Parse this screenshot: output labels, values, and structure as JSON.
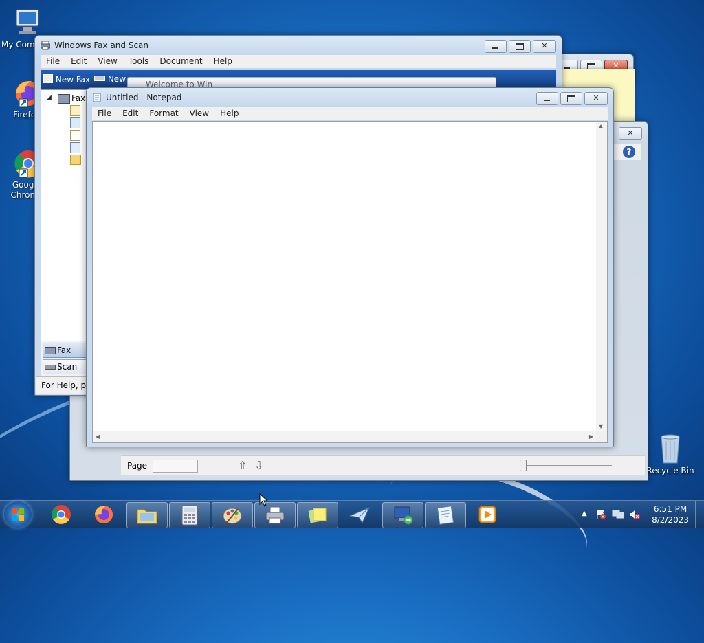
{
  "desktop": {
    "icons": [
      {
        "label": "My Computer"
      },
      {
        "label": "Firefox"
      },
      {
        "label": "Google Chrome"
      },
      {
        "label": "Recycle Bin"
      }
    ]
  },
  "fax_window": {
    "title": "Windows Fax and Scan",
    "menu": [
      "File",
      "Edit",
      "View",
      "Tools",
      "Document",
      "Help"
    ],
    "toolbar": {
      "new_fax": "New Fax",
      "new_scan": "New"
    },
    "welcome_tab": "Welcome to Win",
    "tree_root": "Fax",
    "nav": {
      "fax": "Fax",
      "scan": "Scan"
    },
    "status": "For Help, pre"
  },
  "viewer_window": {
    "page_label": "Page"
  },
  "notepad": {
    "title": "Untitled - Notepad",
    "menu": [
      "File",
      "Edit",
      "Format",
      "View",
      "Help"
    ],
    "content": ""
  },
  "taskbar": {
    "time": "6:51 PM",
    "date": "8/2/2023"
  },
  "colors": {
    "accent": "#1a6fc4",
    "sticky_note": "#fcf8c2"
  }
}
